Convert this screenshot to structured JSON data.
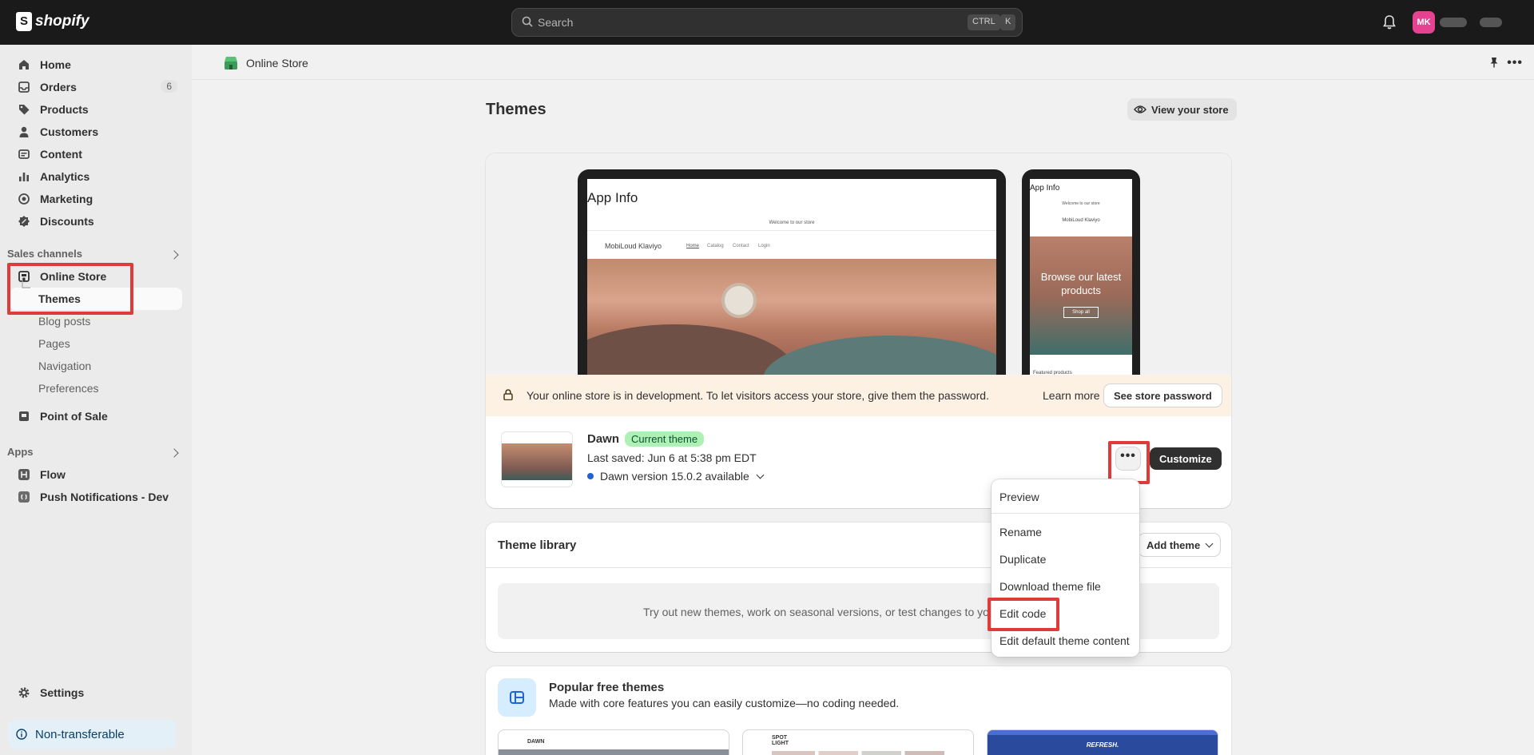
{
  "topbar": {
    "brand": "shopify",
    "search_placeholder": "Search",
    "kbd_ctrl": "CTRL",
    "kbd_k": "K",
    "avatar_initials": "MK"
  },
  "sidebar": {
    "items": [
      {
        "label": "Home",
        "icon": "home-icon"
      },
      {
        "label": "Orders",
        "icon": "inbox-icon",
        "badge": "6"
      },
      {
        "label": "Products",
        "icon": "tag-icon"
      },
      {
        "label": "Customers",
        "icon": "person-icon"
      },
      {
        "label": "Content",
        "icon": "image-icon"
      },
      {
        "label": "Analytics",
        "icon": "bar-chart-icon"
      },
      {
        "label": "Marketing",
        "icon": "target-icon"
      },
      {
        "label": "Discounts",
        "icon": "discount-icon"
      }
    ],
    "sales_channels_title": "Sales channels",
    "online_store": "Online Store",
    "online_store_subitems": [
      "Themes",
      "Blog posts",
      "Pages",
      "Navigation",
      "Preferences"
    ],
    "point_of_sale": "Point of Sale",
    "apps_title": "Apps",
    "apps": [
      "Flow",
      "Push Notifications - Dev"
    ],
    "settings": "Settings",
    "non_transferable": "Non-transferable"
  },
  "header": {
    "breadcrumb": "Online Store"
  },
  "page": {
    "title": "Themes",
    "view_store": "View your store"
  },
  "preview": {
    "laptop_app_title": "App Info",
    "laptop_welcome": "Welcome to our store",
    "laptop_store_name": "MobiLoud Klaviyo",
    "laptop_nav": [
      "Home",
      "Catalog",
      "Contact",
      "Login"
    ],
    "phone_app_title": "App Info",
    "phone_welcome": "Welcome to our store",
    "phone_store_name": "MobiLoud Klaviyo",
    "phone_hero": "Browse our latest products",
    "phone_shop_all": "Shop all",
    "phone_featured": "Featured products"
  },
  "dev_banner": {
    "text": "Your online store is in development. To let visitors access your store, give them the password.",
    "learn_more": "Learn more",
    "see_password": "See store password"
  },
  "current_theme": {
    "name": "Dawn",
    "badge": "Current theme",
    "last_saved": "Last saved: Jun 6 at 5:38 pm EDT",
    "version": "Dawn version 15.0.2 available",
    "customize": "Customize"
  },
  "menu": {
    "items": [
      "Preview",
      "Rename",
      "Duplicate",
      "Download theme file",
      "Edit code",
      "Edit default theme content"
    ]
  },
  "library": {
    "title": "Theme library",
    "add_theme": "Add theme",
    "empty_text": "Try out new themes, work on seasonal versions, or test changes to yo"
  },
  "popular": {
    "title": "Popular free themes",
    "subtitle": "Made with core features you can easily customize—no coding needed.",
    "thumb_labels": [
      "DAWN",
      "SPOT LIGHT",
      "REFRESH."
    ]
  },
  "colors": {
    "topbar": "#1a1a1a",
    "highlight": "#e03b3b",
    "current_badge_bg": "#aff0b5",
    "avatar": "#e54392",
    "info_dot": "#1f63d9"
  }
}
